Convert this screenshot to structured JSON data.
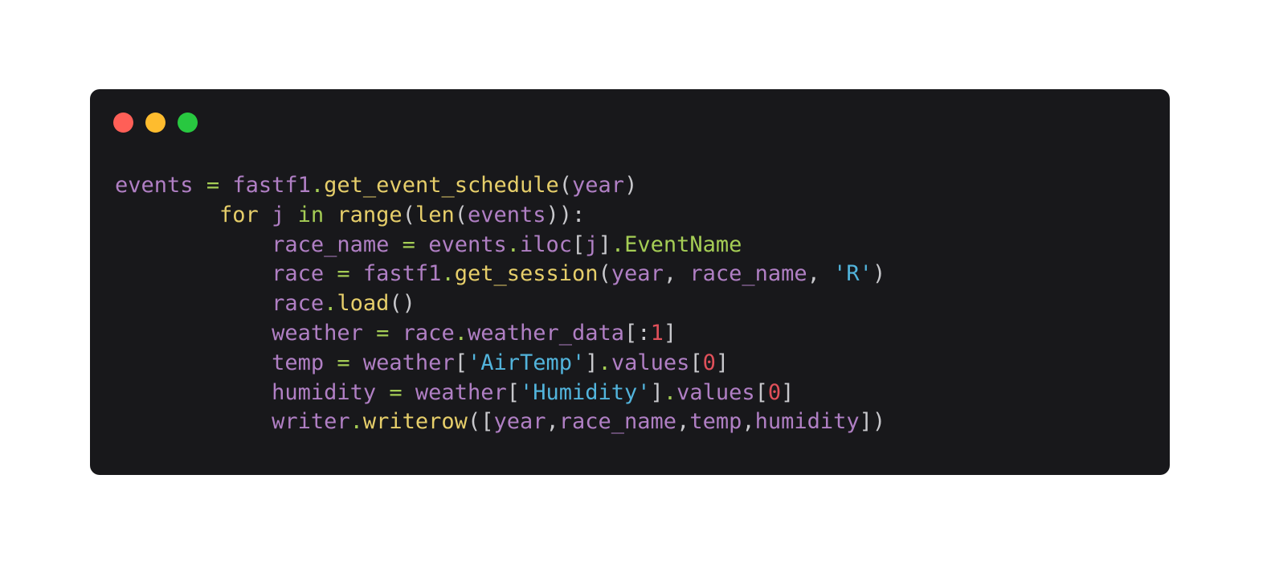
{
  "window": {
    "background": "#18181b",
    "controls": [
      {
        "name": "close-button",
        "icon": "red-circle",
        "color": "#ff5f57"
      },
      {
        "name": "minimize-button",
        "icon": "yellow-circle",
        "color": "#febc2e"
      },
      {
        "name": "maximize-button",
        "icon": "green-circle",
        "color": "#28c840"
      }
    ]
  },
  "theme": {
    "ident": "#b07fc4",
    "call": "#e6ce6a",
    "keyword": "#a5cd55",
    "attr": "#a5cd55",
    "string": "#52b4dc",
    "number": "#e0505a",
    "punct": "#c8c8cc",
    "op": "#a5cd55"
  },
  "code": {
    "lines": [
      [
        {
          "t": "events",
          "k": "ident"
        },
        {
          "t": " ",
          "k": "punct"
        },
        {
          "t": "=",
          "k": "op"
        },
        {
          "t": " ",
          "k": "punct"
        },
        {
          "t": "fastf1",
          "k": "ident"
        },
        {
          "t": ".",
          "k": "attr"
        },
        {
          "t": "get_event_schedule",
          "k": "call"
        },
        {
          "t": "(",
          "k": "punct"
        },
        {
          "t": "year",
          "k": "ident"
        },
        {
          "t": ")",
          "k": "punct"
        }
      ],
      [
        {
          "t": "        ",
          "k": "punct"
        },
        {
          "t": "for",
          "k": "call"
        },
        {
          "t": " ",
          "k": "punct"
        },
        {
          "t": "j",
          "k": "ident"
        },
        {
          "t": " ",
          "k": "punct"
        },
        {
          "t": "in",
          "k": "keyword"
        },
        {
          "t": " ",
          "k": "punct"
        },
        {
          "t": "range",
          "k": "call"
        },
        {
          "t": "(",
          "k": "punct"
        },
        {
          "t": "len",
          "k": "call"
        },
        {
          "t": "(",
          "k": "punct"
        },
        {
          "t": "events",
          "k": "ident"
        },
        {
          "t": ")):",
          "k": "punct"
        }
      ],
      [
        {
          "t": "            ",
          "k": "punct"
        },
        {
          "t": "race_name",
          "k": "ident"
        },
        {
          "t": " ",
          "k": "punct"
        },
        {
          "t": "=",
          "k": "op"
        },
        {
          "t": " ",
          "k": "punct"
        },
        {
          "t": "events",
          "k": "ident"
        },
        {
          "t": ".",
          "k": "attr"
        },
        {
          "t": "iloc",
          "k": "ident"
        },
        {
          "t": "[",
          "k": "punct"
        },
        {
          "t": "j",
          "k": "ident"
        },
        {
          "t": "]",
          "k": "punct"
        },
        {
          "t": ".EventName",
          "k": "attr"
        }
      ],
      [
        {
          "t": "            ",
          "k": "punct"
        },
        {
          "t": "race",
          "k": "ident"
        },
        {
          "t": " ",
          "k": "punct"
        },
        {
          "t": "=",
          "k": "op"
        },
        {
          "t": " ",
          "k": "punct"
        },
        {
          "t": "fastf1",
          "k": "ident"
        },
        {
          "t": ".",
          "k": "attr"
        },
        {
          "t": "get_session",
          "k": "call"
        },
        {
          "t": "(",
          "k": "punct"
        },
        {
          "t": "year",
          "k": "ident"
        },
        {
          "t": ", ",
          "k": "punct"
        },
        {
          "t": "race_name",
          "k": "ident"
        },
        {
          "t": ", ",
          "k": "punct"
        },
        {
          "t": "'R'",
          "k": "string"
        },
        {
          "t": ")",
          "k": "punct"
        }
      ],
      [
        {
          "t": "            ",
          "k": "punct"
        },
        {
          "t": "race",
          "k": "ident"
        },
        {
          "t": ".",
          "k": "attr"
        },
        {
          "t": "load",
          "k": "call"
        },
        {
          "t": "()",
          "k": "punct"
        }
      ],
      [
        {
          "t": "            ",
          "k": "punct"
        },
        {
          "t": "weather",
          "k": "ident"
        },
        {
          "t": " ",
          "k": "punct"
        },
        {
          "t": "=",
          "k": "op"
        },
        {
          "t": " ",
          "k": "punct"
        },
        {
          "t": "race",
          "k": "ident"
        },
        {
          "t": ".",
          "k": "attr"
        },
        {
          "t": "weather_data",
          "k": "ident"
        },
        {
          "t": "[:",
          "k": "punct"
        },
        {
          "t": "1",
          "k": "number"
        },
        {
          "t": "]",
          "k": "punct"
        }
      ],
      [
        {
          "t": "            ",
          "k": "punct"
        },
        {
          "t": "temp",
          "k": "ident"
        },
        {
          "t": " ",
          "k": "punct"
        },
        {
          "t": "=",
          "k": "op"
        },
        {
          "t": " ",
          "k": "punct"
        },
        {
          "t": "weather",
          "k": "ident"
        },
        {
          "t": "[",
          "k": "punct"
        },
        {
          "t": "'AirTemp'",
          "k": "string"
        },
        {
          "t": "]",
          "k": "punct"
        },
        {
          "t": ".",
          "k": "attr"
        },
        {
          "t": "values",
          "k": "ident"
        },
        {
          "t": "[",
          "k": "punct"
        },
        {
          "t": "0",
          "k": "number"
        },
        {
          "t": "]",
          "k": "punct"
        }
      ],
      [
        {
          "t": "            ",
          "k": "punct"
        },
        {
          "t": "humidity",
          "k": "ident"
        },
        {
          "t": " ",
          "k": "punct"
        },
        {
          "t": "=",
          "k": "op"
        },
        {
          "t": " ",
          "k": "punct"
        },
        {
          "t": "weather",
          "k": "ident"
        },
        {
          "t": "[",
          "k": "punct"
        },
        {
          "t": "'Humidity'",
          "k": "string"
        },
        {
          "t": "]",
          "k": "punct"
        },
        {
          "t": ".",
          "k": "attr"
        },
        {
          "t": "values",
          "k": "ident"
        },
        {
          "t": "[",
          "k": "punct"
        },
        {
          "t": "0",
          "k": "number"
        },
        {
          "t": "]",
          "k": "punct"
        }
      ],
      [
        {
          "t": "            ",
          "k": "punct"
        },
        {
          "t": "writer",
          "k": "ident"
        },
        {
          "t": ".",
          "k": "attr"
        },
        {
          "t": "writerow",
          "k": "call"
        },
        {
          "t": "([",
          "k": "punct"
        },
        {
          "t": "year",
          "k": "ident"
        },
        {
          "t": ",",
          "k": "punct"
        },
        {
          "t": "race_name",
          "k": "ident"
        },
        {
          "t": ",",
          "k": "punct"
        },
        {
          "t": "temp",
          "k": "ident"
        },
        {
          "t": ",",
          "k": "punct"
        },
        {
          "t": "humidity",
          "k": "ident"
        },
        {
          "t": "])",
          "k": "punct"
        }
      ]
    ]
  }
}
